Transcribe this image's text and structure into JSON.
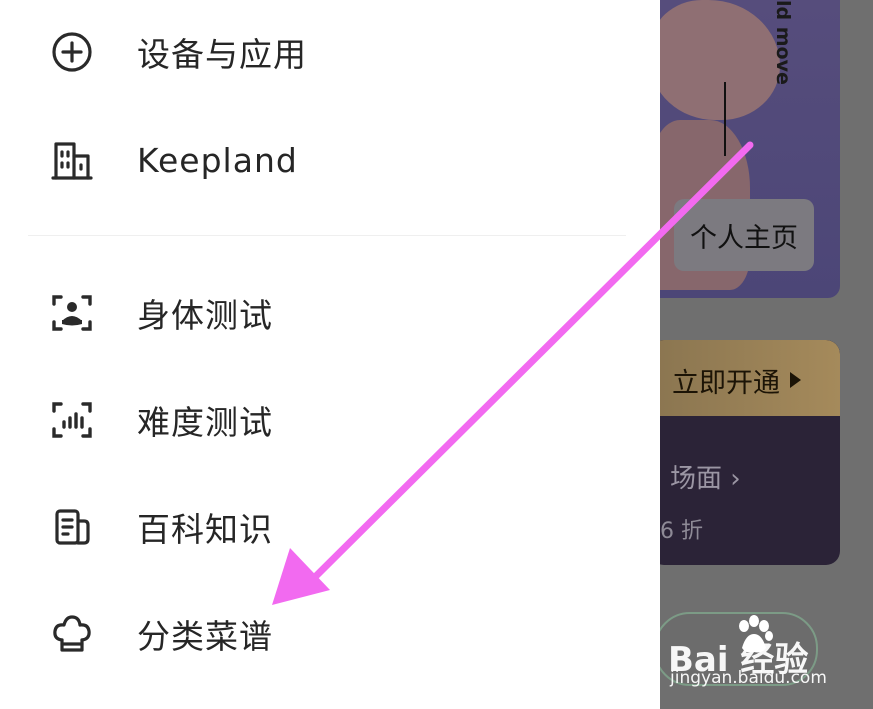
{
  "menu": {
    "items": [
      {
        "label": "设备与应用",
        "icon": "plus-circle-icon"
      },
      {
        "label": "Keepland",
        "icon": "building-icon"
      },
      {
        "label": "身体测试",
        "icon": "body-scan-icon"
      },
      {
        "label": "难度测试",
        "icon": "difficulty-scan-icon"
      },
      {
        "label": "百科知识",
        "icon": "encyclopedia-icon"
      },
      {
        "label": "分类菜谱",
        "icon": "chef-hat-icon"
      }
    ]
  },
  "background": {
    "hero_text": "ld move",
    "profile_button": "个人主页",
    "vip_button": "立即开通",
    "scene_text": "场面 ›",
    "discount_text": "6 折"
  },
  "watermark": {
    "logo": "Bai 经验",
    "url": "jingyan.baidu.com"
  },
  "colors": {
    "arrow": "#f26af0",
    "menu_text": "#262626",
    "icon_stroke": "#2a2a2a"
  }
}
